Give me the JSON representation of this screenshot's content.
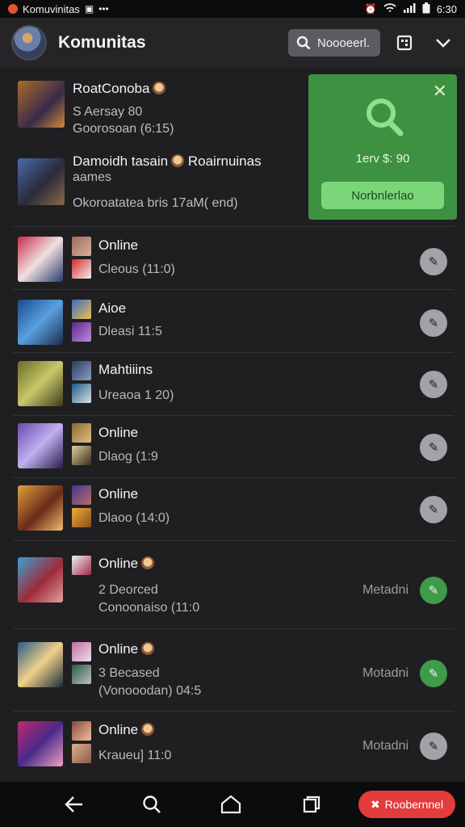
{
  "statusbar": {
    "app_name": "Komuvinitas",
    "time": "6:30"
  },
  "header": {
    "title": "Komunitas",
    "search_label": "Noooeerl."
  },
  "featured": [
    {
      "title": "RoatConoba",
      "line2": "S Aersay 80",
      "line3": "Goorosoan (6:15)"
    },
    {
      "title": "Damoidh tasain",
      "title_suffix": "Roairnuinas",
      "line2": "aames",
      "line3": "Okoroatatea bris 17aM( end)"
    }
  ],
  "promo_card": {
    "text": "1erv $: 90",
    "button_label": "Norbnlerlao"
  },
  "rows": [
    {
      "status": "Online",
      "line2": "Cleous (11:0)",
      "line3": "",
      "meta": "",
      "action": "grey"
    },
    {
      "status": "Aioe",
      "line2": "Dleasi 11:5",
      "line3": "",
      "meta": "",
      "action": "grey"
    },
    {
      "status": "Mahtiiins",
      "line2": "Ureaoa 1 20)",
      "line3": "",
      "meta": "",
      "action": "grey"
    },
    {
      "status": "Online",
      "line2": "Dlaog (1:9",
      "line3": "",
      "meta": "",
      "action": "grey"
    },
    {
      "status": "Online",
      "line2": "Dlaoo (14:0)",
      "line3": "",
      "meta": "",
      "action": "grey"
    },
    {
      "status": "Online",
      "line2": "2 Deorced",
      "line3": "Conoonaiso (11:0",
      "meta": "Metadni",
      "action": "green"
    },
    {
      "status": "Online",
      "line2": "3 Becased",
      "line3": "(Vonooodan) 04:5",
      "meta": "Motadni",
      "action": "green"
    },
    {
      "status": "Online",
      "line2": "Kraueu] 11:0",
      "line3": "",
      "meta": "Motadni",
      "action": "grey"
    }
  ],
  "fab": {
    "label": "Roobernnel"
  },
  "colors": {
    "accent_green": "#3e9140",
    "fab_red": "#e33c3c",
    "background": "#1f1f21"
  }
}
